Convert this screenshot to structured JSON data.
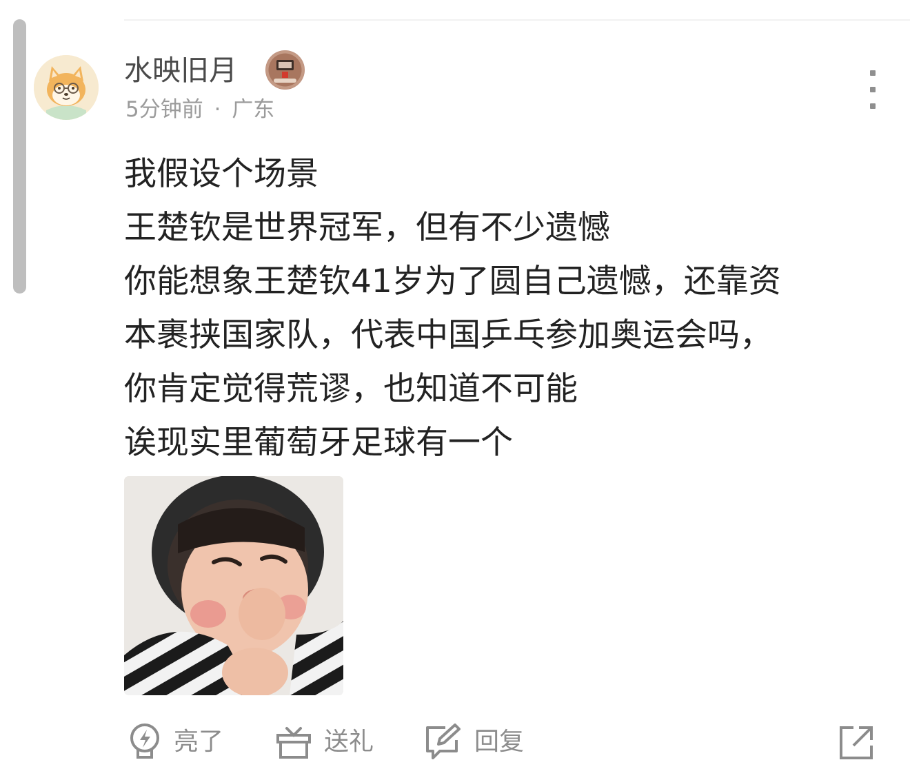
{
  "comment": {
    "username": "水映旧月",
    "time": "5分钟前",
    "separator": "·",
    "location": "广东",
    "lines": [
      "我假设个场景",
      "王楚钦是世界冠军，但有不少遗憾",
      "你能想象王楚钦41岁为了圆自己遗憾，还靠资",
      "本裹挟国家队，代表中国乒乓参加奥运会吗，",
      "你肯定觉得荒谬，也知道不可能",
      "诶现实里葡萄牙足球有一个"
    ]
  },
  "actions": {
    "like_label": "亮了",
    "gift_label": "送礼",
    "reply_label": "回复"
  },
  "icons": {
    "more": "more-vertical-icon",
    "like": "lightbulb-icon",
    "gift": "gift-icon",
    "reply": "reply-edit-icon",
    "share": "share-external-icon"
  },
  "colors": {
    "text_primary": "#222222",
    "text_secondary": "#9b9b9b",
    "icon_gray": "#8c8c8c"
  }
}
